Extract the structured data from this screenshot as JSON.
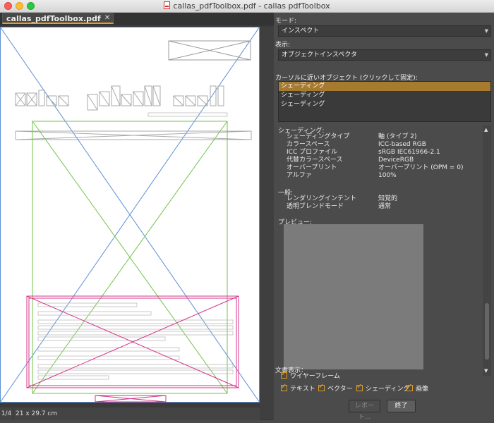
{
  "window": {
    "title": "callas_pdfToolbox.pdf - callas pdfToolbox"
  },
  "document": {
    "tab_label": "callas_pdfToolbox.pdf",
    "close_glyph": "✕",
    "page_indicator": "1/4",
    "page_size": "21 x 29.7 cm"
  },
  "inspector": {
    "mode_label": "モード:",
    "mode_value": "インスペクト",
    "display_label": "表示:",
    "display_value": "オブジェクトインスペクタ",
    "nearby_label": "カーソルに近いオブジェクト (クリックして固定):",
    "nearby_items": [
      "シェーディング",
      "シェーディング",
      "シェーディング"
    ],
    "shading_section": "シェーディング:",
    "shading_props": [
      {
        "key": "シェーディングタイプ",
        "value": "軸 (タイプ 2)"
      },
      {
        "key": "カラースペース",
        "value": "ICC-based RGB"
      },
      {
        "key": "ICC プロファイル",
        "value": "sRGB IEC61966-2.1"
      },
      {
        "key": "代替カラースペース",
        "value": "DeviceRGB"
      },
      {
        "key": "オーバープリント",
        "value": "オーバープリント (OPM = 0)"
      },
      {
        "key": "アルファ",
        "value": "100%"
      }
    ],
    "general_section": "一般:",
    "general_props": [
      {
        "key": "レンダリングインテント",
        "value": "知覚的"
      },
      {
        "key": "透明ブレンドモード",
        "value": "通常"
      }
    ],
    "preview_label": "プレビュー:",
    "doc_display_label": "文書表示：",
    "wireframe_label": "ワイヤーフレーム",
    "checks": [
      "テキスト",
      "ベクター",
      "シェーディング",
      "画像"
    ],
    "report_button": "レポート...",
    "close_button": "終了"
  },
  "colors": {
    "accent": "#e6a31a",
    "selection": "#a67a2f",
    "wire_blue": "#5b8fd6",
    "wire_green": "#72c44a",
    "wire_magenta": "#d6338a"
  }
}
